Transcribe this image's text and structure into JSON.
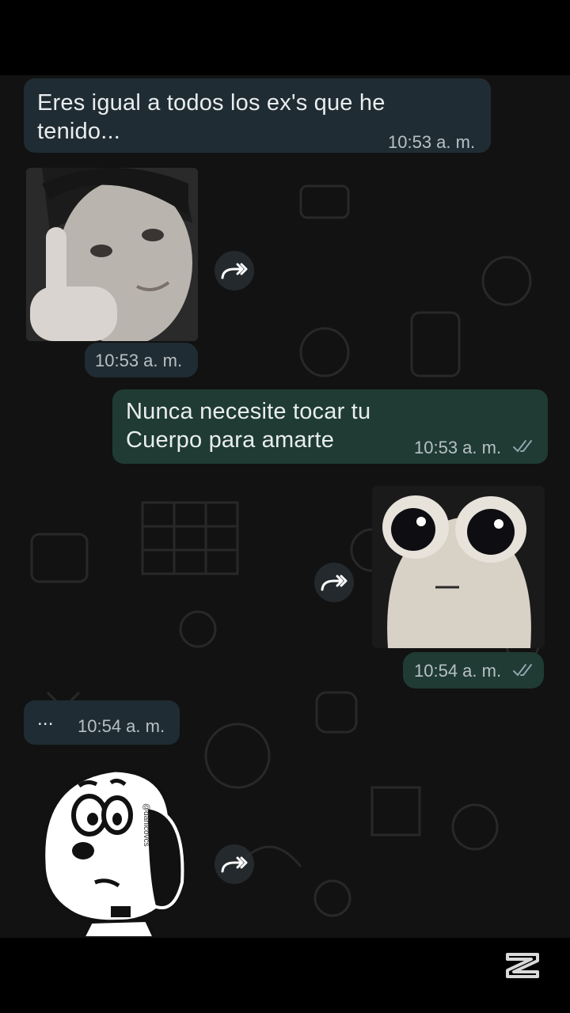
{
  "messages": {
    "m1": {
      "text_line1": "Eres igual a todos los ex's que he",
      "text_line2": "tenido...",
      "time": "10:53 a. m."
    },
    "m2": {
      "time": "10:53 a. m."
    },
    "m3": {
      "text_line1": "Nunca  necesite  tocar  tu",
      "text_line2": "Cuerpo  para  amarte",
      "time": "10:53 a. m.",
      "status": "read"
    },
    "m4": {
      "time": "10:54 a. m.",
      "status": "read"
    },
    "m5": {
      "text": "...",
      "time": "10:54 a. m."
    }
  },
  "sticker": {
    "credit": "@danicovcs"
  },
  "icons": {
    "forward": "forward-icon",
    "ticks": "double-check-icon",
    "watermark": "capcut-logo"
  },
  "colors": {
    "incoming": "#202c33",
    "outgoing": "#1f3b33",
    "background": "#121212"
  }
}
